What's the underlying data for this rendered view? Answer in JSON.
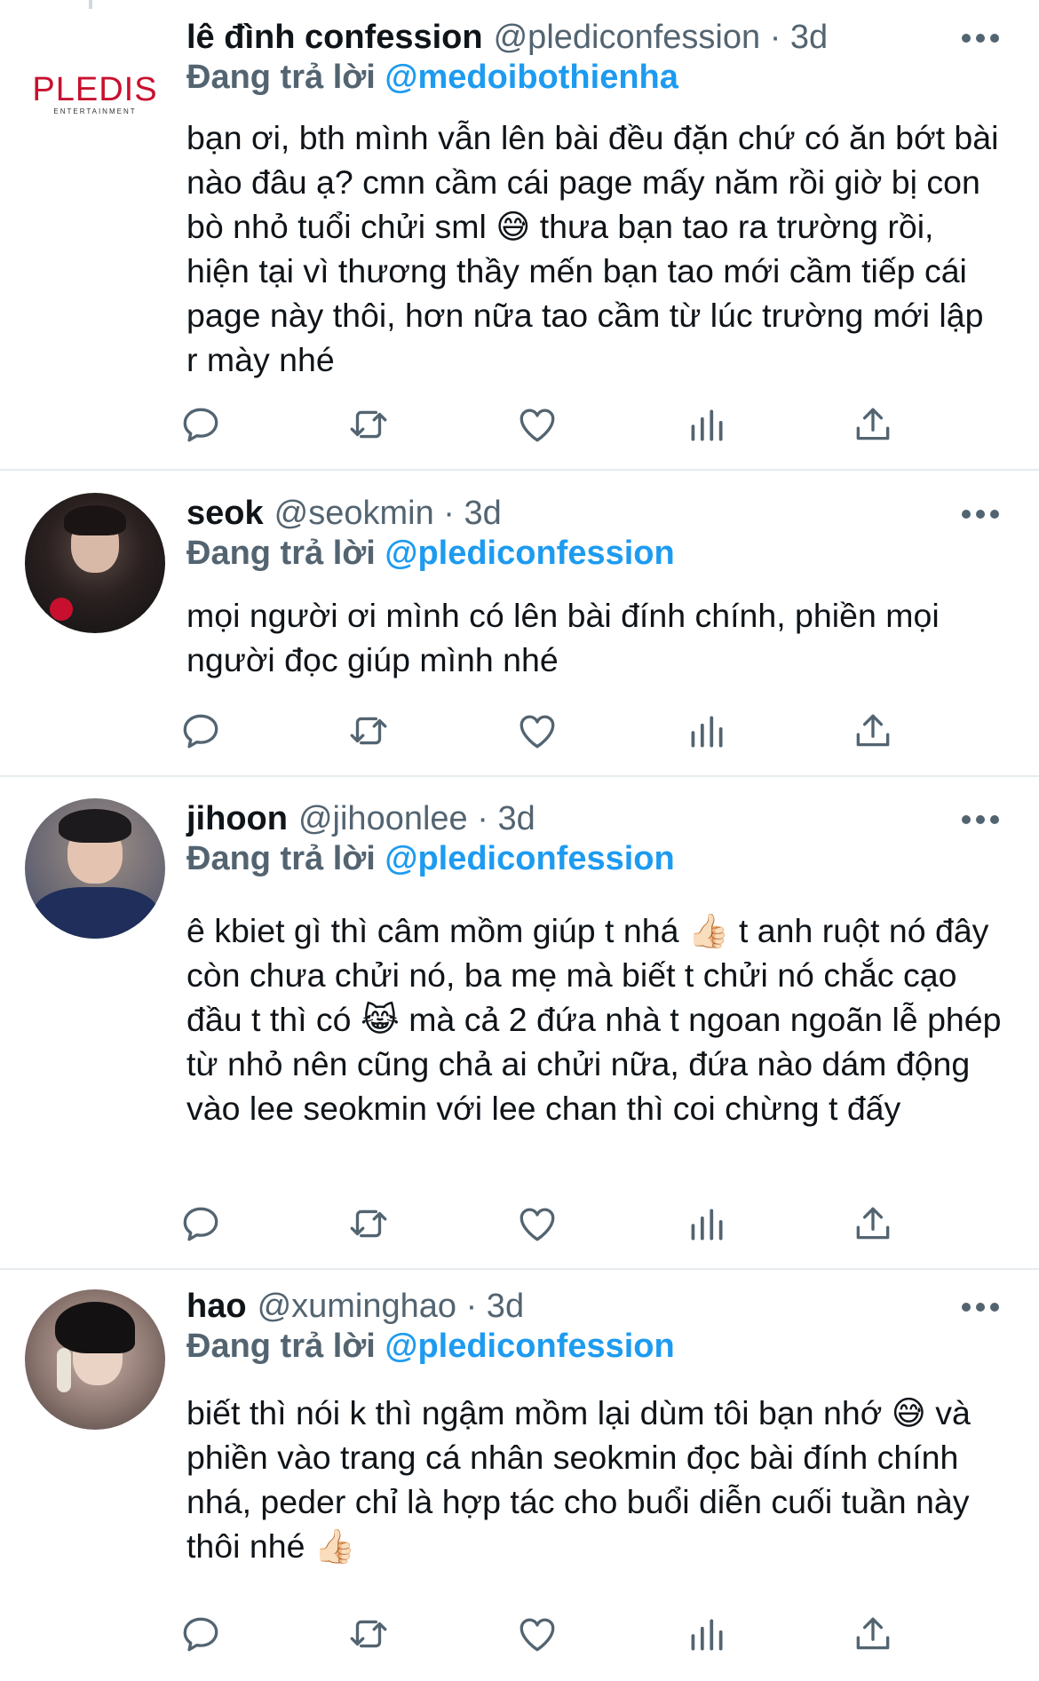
{
  "tweets": [
    {
      "name": "lê đình confession",
      "meta": "@plediconfession · 3d",
      "replying_label": "Đang trả lời",
      "replying_to": "@medoibothienha",
      "text": "bạn ơi, bth mình vẫn lên bài đều đặn chứ có ăn bớt bài nào đâu ạ? cmn cầm cái page mấy năm rồi giờ bị con bò nhỏ tuổi chửi sml 😅 thưa bạn tao ra trường rồi, hiện tại vì thương thầy mến bạn tao mới cầm tiếp cái page này thôi, hơn nữa tao cầm từ lúc trường mới lập r mày nhé",
      "avatar": "pledis-logo",
      "avatar_text": "PLEDIS",
      "avatar_subtext": "ENTERTAINMENT"
    },
    {
      "name": "seok",
      "meta": "@seokmin · 3d",
      "replying_label": "Đang trả lời",
      "replying_to": "@plediconfession",
      "text": "mọi người ơi mình có lên bài đính chính, phiền mọi người đọc giúp mình nhé",
      "avatar": "user-photo"
    },
    {
      "name": "jihoon",
      "meta": "@jihoonlee · 3d",
      "replying_label": "Đang trả lời",
      "replying_to": "@plediconfession",
      "text": "ê kbiet gì thì câm mồm giúp t nhá 👍🏻 t anh ruột nó đây còn chưa chửi nó, ba mẹ mà biết t chửi nó chắc cạo đầu t thì có 😹 mà cả 2 đứa nhà t ngoan ngoãn lễ phép từ nhỏ nên cũng chả ai chửi nữa, đứa nào dám động vào lee seokmin với lee chan thì coi chừng t đấy",
      "avatar": "user-photo"
    },
    {
      "name": "hao",
      "meta": "@xuminghao · 3d",
      "replying_label": "Đang trả lời",
      "replying_to": "@plediconfession",
      "text": "biết thì nói k thì ngậm mồm lại dùm tôi bạn nhớ 😅 và phiền vào trang cá nhân seokmin đọc bài đính chính nhá, peder chỉ là hợp tác cho buổi diễn cuối tuần này thôi nhé 👍🏻",
      "avatar": "user-photo"
    }
  ],
  "icons": [
    "reply-icon",
    "retweet-icon",
    "like-icon",
    "analytics-icon",
    "share-icon",
    "more-icon"
  ],
  "colors": {
    "accent": "#1d9bf0",
    "secondary_text": "#536471",
    "brand_red": "#c8102e"
  }
}
